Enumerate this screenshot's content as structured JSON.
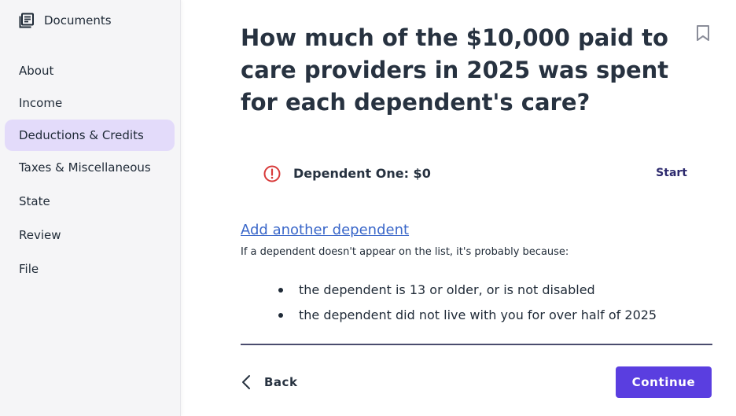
{
  "sidebar": {
    "documents_label": "Documents",
    "items": [
      {
        "label": "About"
      },
      {
        "label": "Income"
      },
      {
        "label": "Deductions & Credits",
        "active": true
      },
      {
        "label": "Taxes & Miscellaneous"
      },
      {
        "label": "State"
      },
      {
        "label": "Review"
      },
      {
        "label": "File"
      }
    ]
  },
  "main": {
    "title": "How much of the $10,000 paid to care providers in 2025 was spent for each dependent's care?",
    "dependent": {
      "label": "Dependent One: $0",
      "action": "Start",
      "status_icon": "alert-circle-icon"
    },
    "add_dependent": "Add another dependent",
    "info_text": "If a dependent doesn't appear on the list, it's probably because:",
    "reasons": [
      "the dependent is 13 or older, or is not disabled",
      "the dependent did not live with you for over half of 2025"
    ]
  },
  "footer": {
    "back_label": "Back",
    "continue_label": "Continue"
  },
  "colors": {
    "accent": "#5a3ee0",
    "active_nav": "#e3dbfa",
    "alert": "#d83a3a",
    "link": "#3a67c9"
  }
}
